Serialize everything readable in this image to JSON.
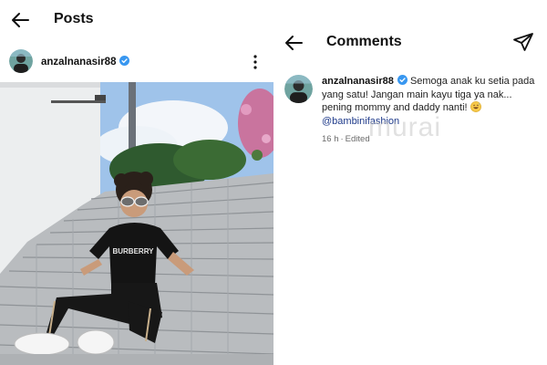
{
  "posts": {
    "title": "Posts",
    "author": {
      "username": "anzalnanasir88",
      "verified": true
    },
    "photo_shirt_text": "BURBERRY"
  },
  "comments": {
    "title": "Comments",
    "items": [
      {
        "username": "anzalnanasir88",
        "verified": true,
        "text": "Semoga anak ku setia pada yang satu! Jangan main kayu tiga ya nak... pening mommy and daddy nanti!",
        "emoji": "grinning-sweat-emoji",
        "mention": "@bambinifashion",
        "time": "16 h",
        "status": "Edited"
      }
    ]
  },
  "watermark": "murai",
  "icons": {
    "back": "arrow-left-icon",
    "more": "more-vertical-icon",
    "send": "paper-plane-icon",
    "verified": "verified-badge-icon"
  },
  "colors": {
    "verified_blue": "#3897f0",
    "mention_blue": "#1e3a8a",
    "muted_text": "#6b6b6b"
  }
}
